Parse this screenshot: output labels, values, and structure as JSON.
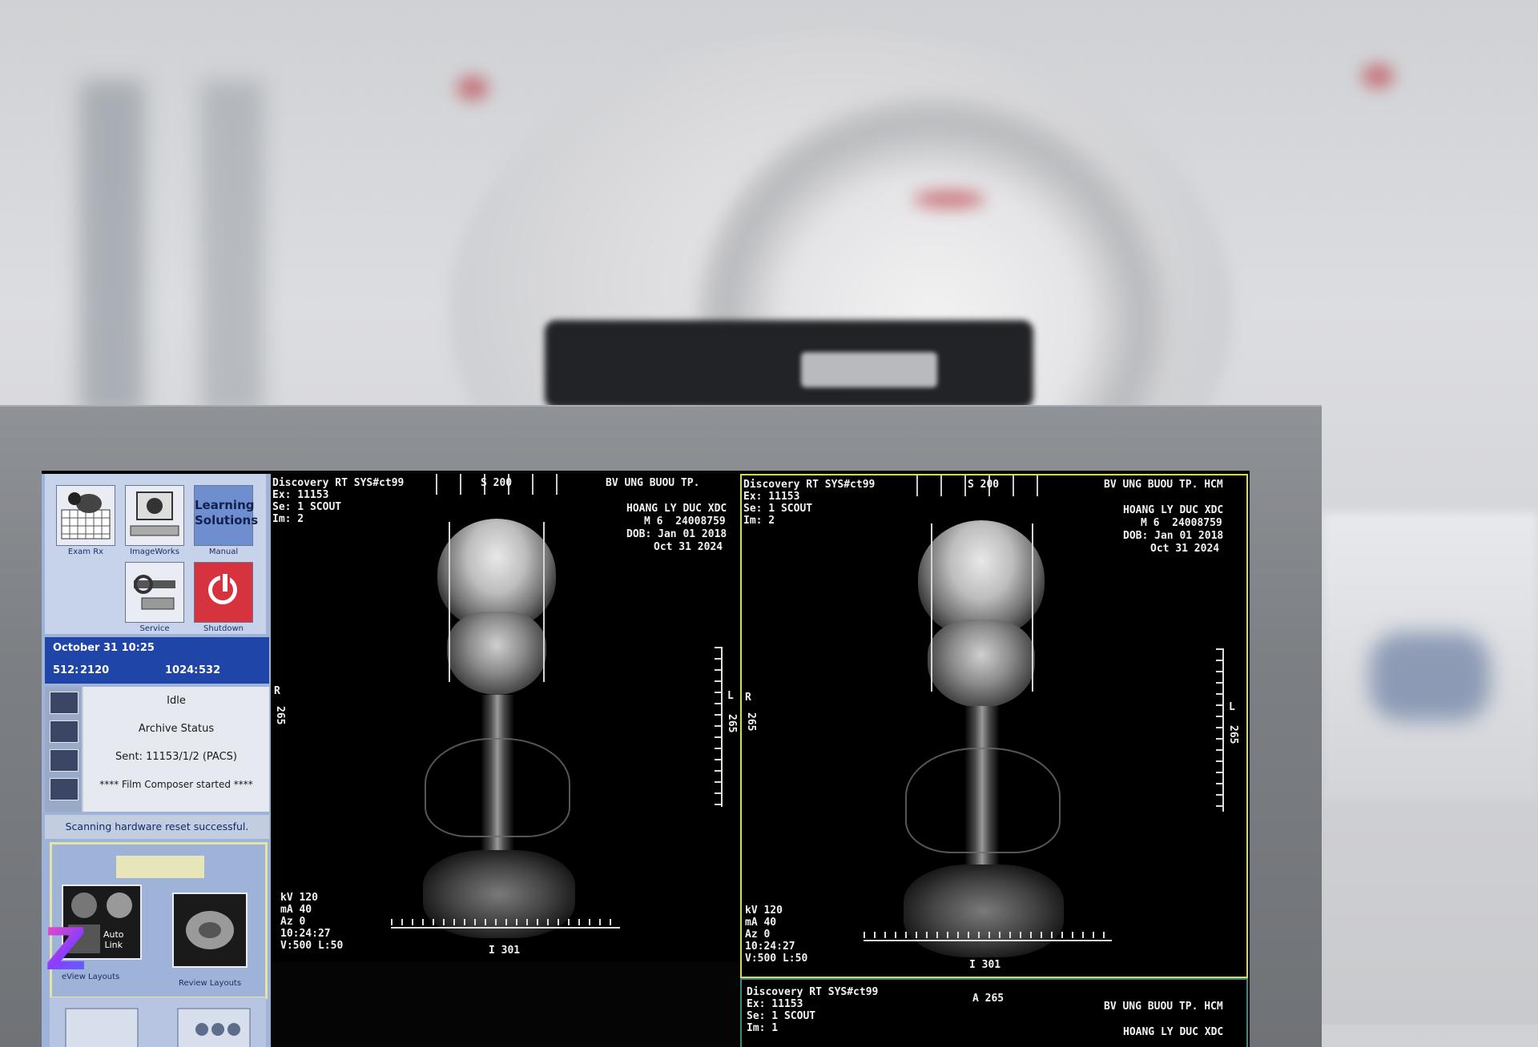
{
  "panel": {
    "tiles": [
      {
        "label": "Exam Rx",
        "icon": "exam-rx-icon"
      },
      {
        "label": "ImageWorks",
        "icon": "imageworks-icon"
      },
      {
        "label": "Learning\nSolutions",
        "caption": "Manual",
        "icon": "learning-solutions-icon"
      },
      {
        "label": "Service",
        "icon": "service-icon"
      },
      {
        "label": "Shutdown",
        "icon": "power-icon"
      }
    ],
    "date": "October 31 10:25",
    "counter_512_label": "512:",
    "counter_512_value": "2120",
    "counter_1024_label": "1024:",
    "counter_1024_value": "532",
    "status_lines": [
      "Idle",
      "Archive Status",
      "Sent: 11153/1/2 (PACS)",
      "**** Film Composer started ****"
    ],
    "message": "Scanning hardware reset successful.",
    "auto_link_label": "Auto\nLink",
    "review_layouts_left": "eView Layouts",
    "review_layouts_right": "Review Layouts"
  },
  "viewports": [
    {
      "site": "Discovery RT SYS#ct99",
      "exam": "Ex: 11153",
      "series": "Se: 1 SCOUT",
      "image": "Im: 2",
      "top_marker": "S 200",
      "hospital": "BV UNG BUOU TP.",
      "patient": "HOANG LY DUC XDC",
      "patient_id": "M 6  24008759",
      "dob": "DOB: Jan 01 2018",
      "date": "Oct 31 2024",
      "left_marker": "R",
      "left_value": "265",
      "right_marker": "L",
      "right_value": "265",
      "kv": "kV 120",
      "ma": "mA 40",
      "az": "Az 0",
      "time": "10:24:27",
      "window": "V:500 L:50",
      "bottom_marker": "I 301"
    },
    {
      "site": "Discovery RT SYS#ct99",
      "exam": "Ex: 11153",
      "series": "Se: 1 SCOUT",
      "image": "Im: 2",
      "top_marker": "S 200",
      "hospital": "BV UNG BUOU TP. HCM",
      "patient": "HOANG LY DUC XDC",
      "patient_id": "M 6  24008759",
      "dob": "DOB: Jan 01 2018",
      "date": "Oct 31 2024",
      "left_marker": "R",
      "left_value": "265",
      "right_marker": "L",
      "right_value": "265",
      "kv": "kV 120",
      "ma": "mA 40",
      "az": "Az 0",
      "time": "10:24:27",
      "window": "V:500 L:50",
      "bottom_marker": "I 301"
    }
  ],
  "third_viewport": {
    "site": "Discovery RT SYS#ct99",
    "exam": "Ex: 11153",
    "series": "Se: 1 SCOUT",
    "image": "Im: 1",
    "top_marker": "A 265",
    "hospital": "BV UNG BUOU TP. HCM",
    "patient": "HOANG LY DUC XDC"
  },
  "watermark": "Z"
}
